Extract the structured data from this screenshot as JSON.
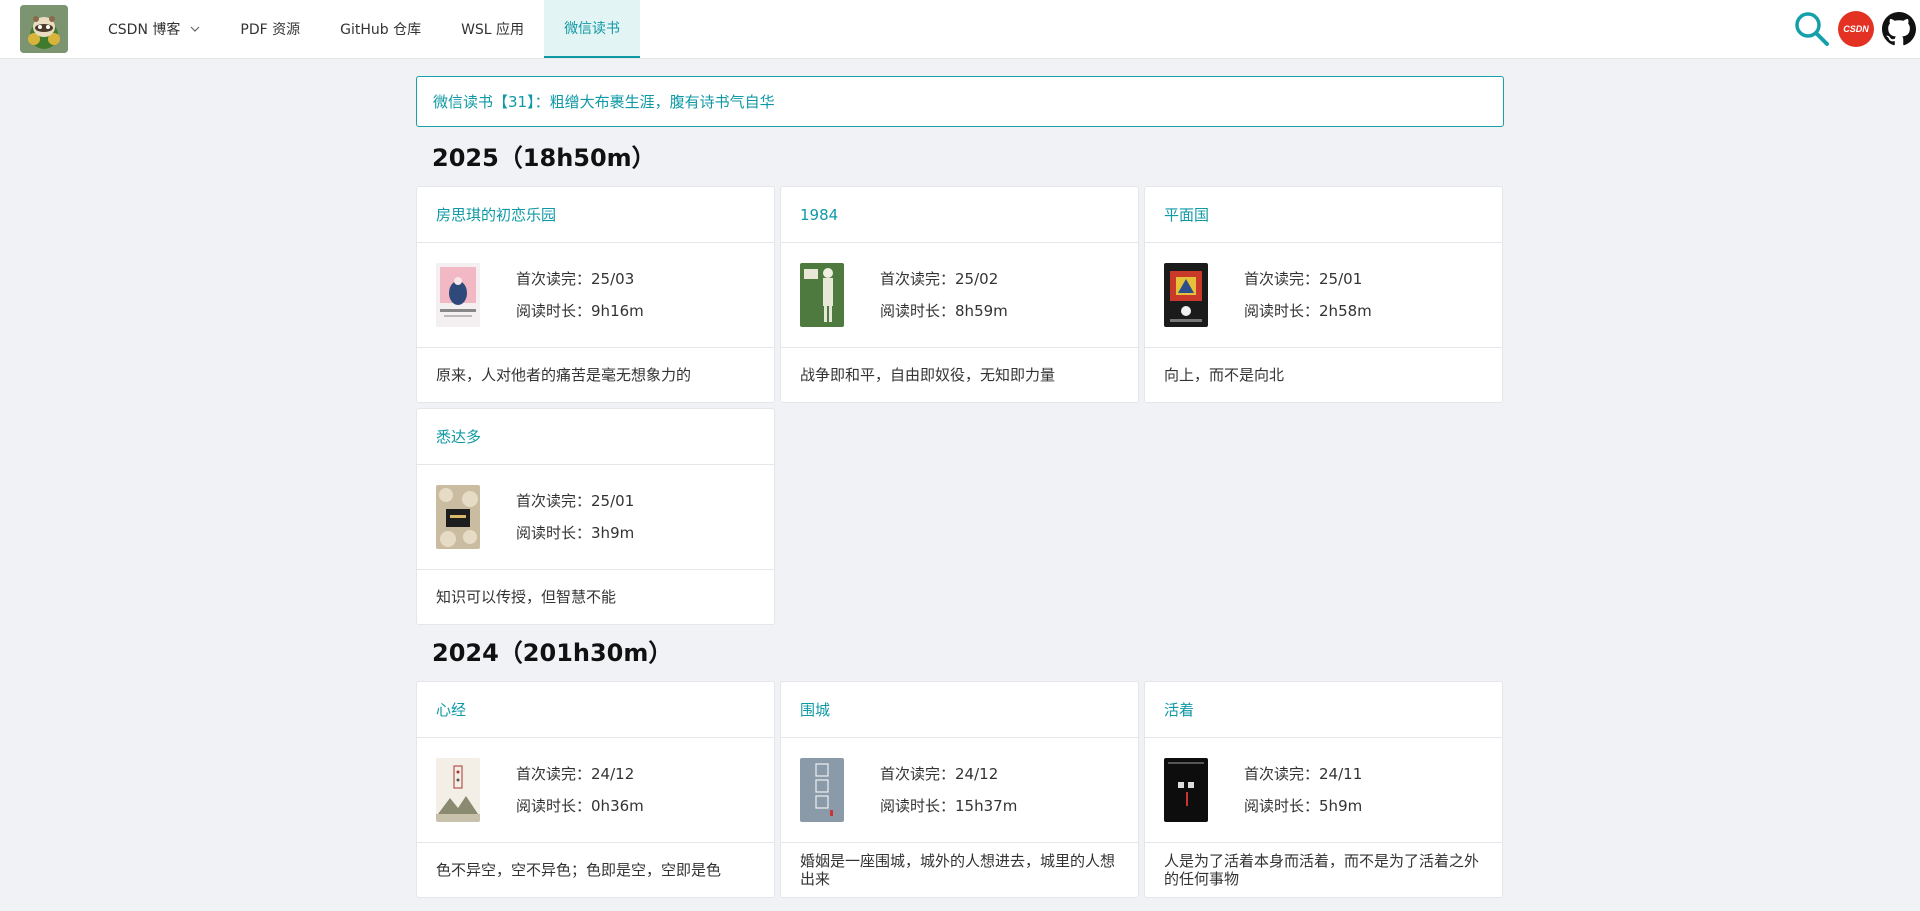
{
  "nav": {
    "items": [
      {
        "label": "CSDN 博客",
        "has_dropdown": true,
        "active": false
      },
      {
        "label": "PDF 资源",
        "has_dropdown": false,
        "active": false
      },
      {
        "label": "GitHub 仓库",
        "has_dropdown": false,
        "active": false
      },
      {
        "label": "WSL 应用",
        "has_dropdown": false,
        "active": false
      },
      {
        "label": "微信读书",
        "has_dropdown": false,
        "active": true
      }
    ],
    "right_icons": [
      "search-icon",
      "csdn-logo-icon",
      "github-icon"
    ],
    "csdn_badge_text": "CSDN"
  },
  "banner": {
    "text": "微信读书【31】：粗缯大布裹生涯，腹有诗书气自华"
  },
  "sections": [
    {
      "title": "2025（18h50m）",
      "books": [
        {
          "title": "房思琪的初恋乐园",
          "first_read_label": "首次读完：",
          "first_read": "25/03",
          "duration_label": "阅读时长：",
          "duration": "9h16m",
          "quote": "原来，人对他者的痛苦是毫无想象力的"
        },
        {
          "title": "1984",
          "first_read_label": "首次读完：",
          "first_read": "25/02",
          "duration_label": "阅读时长：",
          "duration": "8h59m",
          "quote": "战争即和平，自由即奴役，无知即力量"
        },
        {
          "title": "平面国",
          "first_read_label": "首次读完：",
          "first_read": "25/01",
          "duration_label": "阅读时长：",
          "duration": "2h58m",
          "quote": "向上，而不是向北"
        },
        {
          "title": "悉达多",
          "first_read_label": "首次读完：",
          "first_read": "25/01",
          "duration_label": "阅读时长：",
          "duration": "3h9m",
          "quote": "知识可以传授，但智慧不能"
        }
      ]
    },
    {
      "title": "2024（201h30m）",
      "books": [
        {
          "title": "心经",
          "first_read_label": "首次读完：",
          "first_read": "24/12",
          "duration_label": "阅读时长：",
          "duration": "0h36m",
          "quote": "色不异空，空不异色；色即是空，空即是色"
        },
        {
          "title": "围城",
          "first_read_label": "首次读完：",
          "first_read": "24/12",
          "duration_label": "阅读时长：",
          "duration": "15h37m",
          "quote": "婚姻是一座围城，城外的人想进去，城里的人想出来"
        },
        {
          "title": "活着",
          "first_read_label": "首次读完：",
          "first_read": "24/11",
          "duration_label": "阅读时长：",
          "duration": "5h9m",
          "quote": "人是为了活着本身而活着，而不是为了活着之外的任何事物"
        }
      ]
    }
  ],
  "colors": {
    "accent": "#0f99a5",
    "page_bg": "#f0f2f5",
    "csdn_red": "#e33224"
  }
}
